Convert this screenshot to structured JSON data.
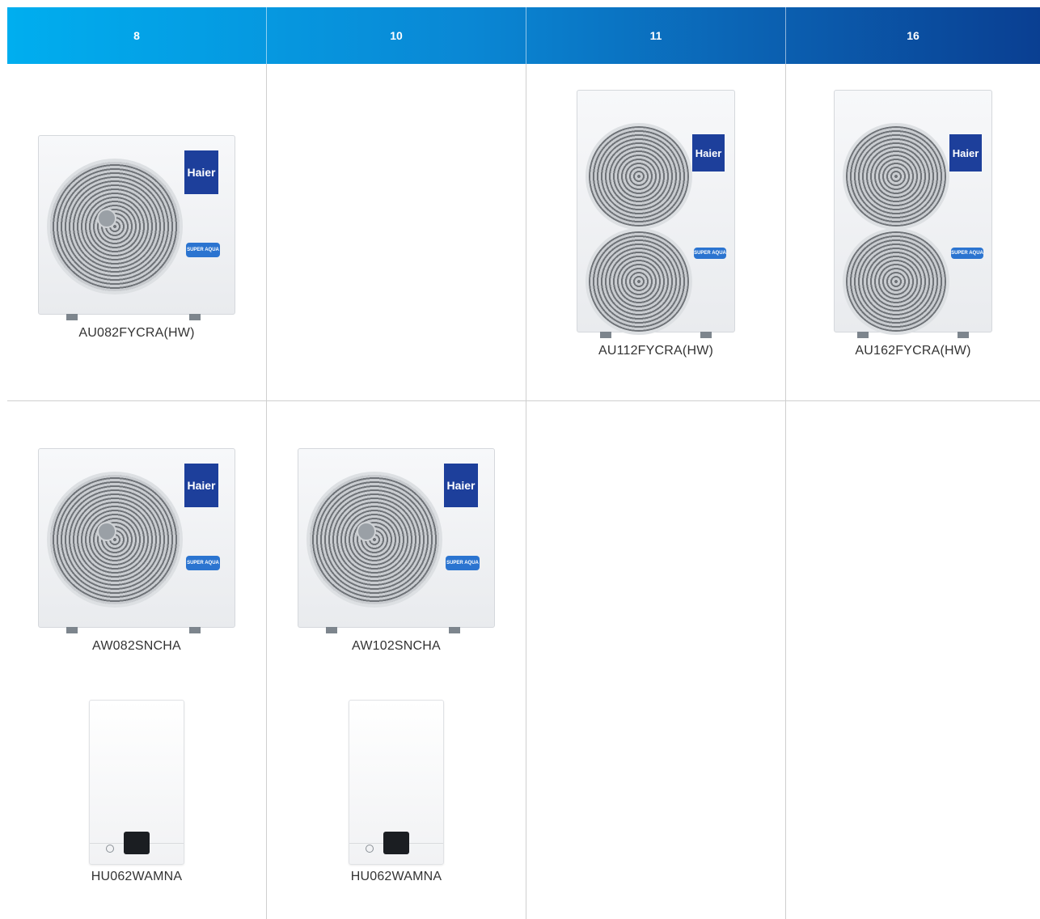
{
  "columns": [
    "8",
    "10",
    "11",
    "16"
  ],
  "row1": {
    "col1_model": "AU082FYCRA(HW)",
    "col3_model": "AU112FYCRA(HW)",
    "col4_model": "AU162FYCRA(HW)"
  },
  "row2": {
    "col1_outdoor_model": "AW082SNCHA",
    "col1_indoor_model": "HU062WAMNA",
    "col2_outdoor_model": "AW102SNCHA",
    "col2_indoor_model": "HU062WAMNA"
  },
  "branding": {
    "logo_text": "Haier",
    "badge_text": "SUPER AQUA",
    "logo_color": "#1d3f9b",
    "header_gradient": [
      "#00aeef",
      "#0a3f92"
    ]
  }
}
